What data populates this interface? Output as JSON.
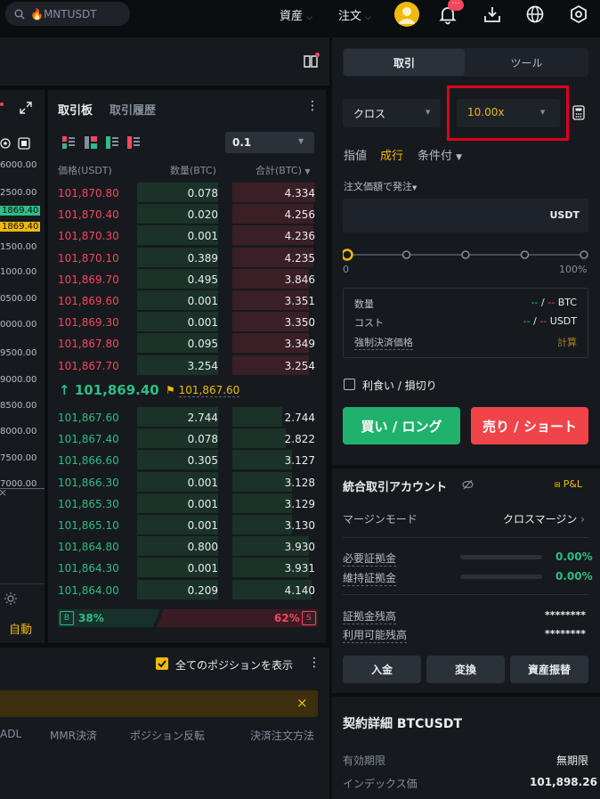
{
  "header": {
    "search_text": "🔥MNTUSDT",
    "assets": "資産",
    "orders": "注文",
    "notif_badge": "⋯"
  },
  "chart_axis": {
    "labels": [
      "6000.00",
      "2500.00",
      "1869.40",
      "1869.40",
      "1500.00",
      "1000.00",
      "0500.00",
      "0000.00",
      "9500.00",
      "9000.00",
      "8500.00",
      "8000.00",
      "7500.00",
      "7000.00"
    ],
    "auto": "自動"
  },
  "orderbook": {
    "tab_book": "取引板",
    "tab_history": "取引履歴",
    "precision": "0.1",
    "col_price": "価格(USDT)",
    "col_qty": "数量(BTC)",
    "col_total": "合計(BTC)",
    "asks": [
      {
        "price": "101,870.80",
        "qty": "0.078",
        "total": "4.334",
        "qf": 1.0,
        "tf": 1.0
      },
      {
        "price": "101,870.40",
        "qty": "0.020",
        "total": "4.256",
        "qf": 1.0,
        "tf": 0.98
      },
      {
        "price": "101,870.30",
        "qty": "0.001",
        "total": "4.236",
        "qf": 1.0,
        "tf": 0.98
      },
      {
        "price": "101,870.10",
        "qty": "0.389",
        "total": "4.235",
        "qf": 1.0,
        "tf": 0.98
      },
      {
        "price": "101,869.70",
        "qty": "0.495",
        "total": "3.846",
        "qf": 1.0,
        "tf": 0.92
      },
      {
        "price": "101,869.60",
        "qty": "0.001",
        "total": "3.351",
        "qf": 1.0,
        "tf": 0.92
      },
      {
        "price": "101,869.30",
        "qty": "0.001",
        "total": "3.350",
        "qf": 1.0,
        "tf": 0.92
      },
      {
        "price": "101,867.80",
        "qty": "0.095",
        "total": "3.349",
        "qf": 1.0,
        "tf": 0.92
      },
      {
        "price": "101,867.70",
        "qty": "3.254",
        "total": "3.254",
        "qf": 1.0,
        "tf": 0.92
      }
    ],
    "last_price": "101,869.40",
    "mark_price": "101,867.60",
    "bids": [
      {
        "price": "101,867.60",
        "qty": "2.744",
        "total": "2.744",
        "qf": 1.0,
        "tf": 0.6
      },
      {
        "price": "101,867.40",
        "qty": "0.078",
        "total": "2.822",
        "qf": 1.0,
        "tf": 0.65
      },
      {
        "price": "101,866.60",
        "qty": "0.305",
        "total": "3.127",
        "qf": 1.0,
        "tf": 0.72
      },
      {
        "price": "101,866.30",
        "qty": "0.001",
        "total": "3.128",
        "qf": 1.0,
        "tf": 0.72
      },
      {
        "price": "101,865.30",
        "qty": "0.001",
        "total": "3.129",
        "qf": 1.0,
        "tf": 0.72
      },
      {
        "price": "101,865.10",
        "qty": "0.001",
        "total": "3.130",
        "qf": 1.0,
        "tf": 0.72
      },
      {
        "price": "101,864.80",
        "qty": "0.800",
        "total": "3.930",
        "qf": 1.0,
        "tf": 0.92
      },
      {
        "price": "101,864.30",
        "qty": "0.001",
        "total": "3.931",
        "qf": 1.0,
        "tf": 0.92
      },
      {
        "price": "101,864.00",
        "qty": "0.209",
        "total": "4.140",
        "qf": 1.0,
        "tf": 0.96
      }
    ],
    "buy_badge": "B",
    "buy_pct": "38%",
    "sell_pct": "62%",
    "sell_badge": "S",
    "buy_ratio": 0.38
  },
  "positions": {
    "show_all": "全てのポジションを表示",
    "cols": [
      "ADL",
      "MMR決済",
      "ポジション反転",
      "決済注文方法"
    ],
    "close_icon": "×"
  },
  "trade": {
    "tab_trade": "取引",
    "tab_tools": "ツール",
    "margin_mode": "クロス",
    "leverage": "10.00x",
    "type_limit": "指値",
    "type_market": "成行",
    "type_conditional": "条件付",
    "order_by": "注文価額で発注",
    "input_unit": "USDT",
    "slider_min": "0",
    "slider_max": "100%",
    "slider_value": 0,
    "qty_label": "数量",
    "qty_value_a": "--",
    "qty_value_b": "--",
    "qty_unit": "BTC",
    "cost_label": "コスト",
    "cost_value_a": "--",
    "cost_value_b": "--",
    "cost_unit": "USDT",
    "liq_label": "強制決済価格",
    "liq_value": "計算",
    "tpsl": "利食い / 損切り",
    "buy_btn": "買い / ロング",
    "sell_btn": "売り / ショート"
  },
  "account": {
    "title": "統合取引アカウント",
    "pnl": "P&L",
    "margin_mode_label": "マージンモード",
    "margin_mode_value": "クロスマージン",
    "im_label": "必要証拠金",
    "im_value": "0.00%",
    "mm_label": "維持証拠金",
    "mm_value": "0.00%",
    "balance_label": "証拠金残高",
    "balance_value": "********",
    "avail_label": "利用可能残高",
    "avail_value": "********",
    "deposit": "入金",
    "convert": "変換",
    "transfer": "資産振替"
  },
  "contract": {
    "title": "契約詳細 BTCUSDT",
    "expiry_label": "有効期限",
    "expiry_value": "無期限",
    "index_label": "インデックス価",
    "index_value": "101,898.26"
  },
  "colors": {
    "ask": "#f6465d",
    "bid": "#2ebd85",
    "accent": "#f0b90b",
    "highlight": "#e0001b"
  }
}
